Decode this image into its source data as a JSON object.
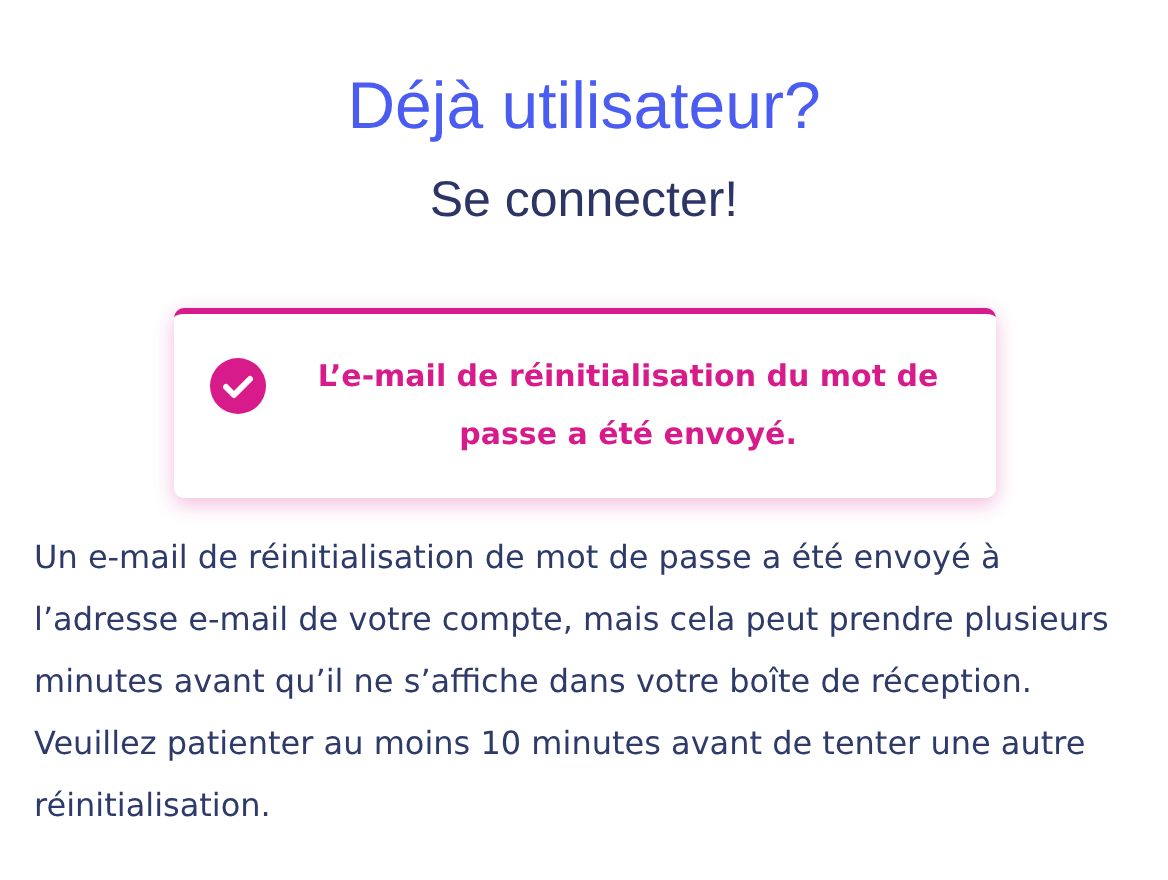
{
  "heading": {
    "title": "Déjà utilisateur?",
    "subtitle": "Se connecter!"
  },
  "alert": {
    "kind": "success",
    "message": "L’e-mail de réinitialisation du mot de passe a été envoyé."
  },
  "paragraph": "Un e-mail de réinitialisation de mot de passe a été envoyé à l’adresse e-mail de votre compte, mais cela peut prendre plusieurs minutes avant qu’il ne s’affiche dans votre boîte de réception. Veuillez patienter au moins 10 minutes avant de tenter une autre réinitialisation."
}
